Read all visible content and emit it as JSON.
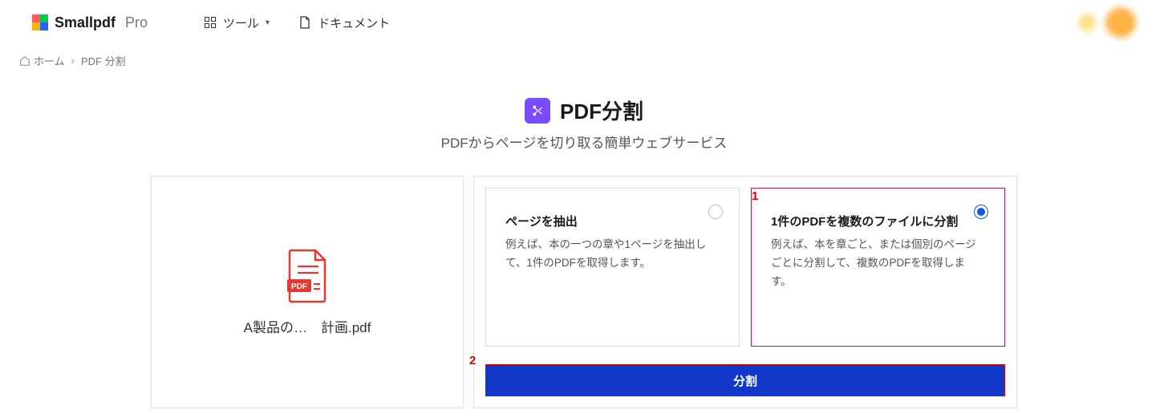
{
  "header": {
    "brand_main": "Smallpdf",
    "brand_suffix": "Pro",
    "nav": {
      "tools": "ツール",
      "documents": "ドキュメント"
    }
  },
  "breadcrumb": {
    "home": "ホーム",
    "separator": "›",
    "current": "PDF 分割"
  },
  "hero": {
    "title": "PDF分割",
    "subtitle": "PDFからページを切り取る簡単ウェブサービス"
  },
  "file": {
    "name": "A製品の…　計画.pdf"
  },
  "options": {
    "extract": {
      "title": "ページを抽出",
      "desc": "例えば、本の一つの章や1ページを抽出して、1件のPDFを取得します。",
      "selected": false
    },
    "split": {
      "title": "1件のPDFを複数のファイルに分割",
      "desc": "例えば、本を章ごと、または個別のページごとに分割して、複数のPDFを取得します。",
      "selected": true
    }
  },
  "actions": {
    "split_button": "分割"
  },
  "annotations": {
    "a1": "1",
    "a2": "2"
  },
  "colors": {
    "accent": "#7b4cff",
    "primary_button": "#1138c9",
    "selected_border": "#c2185b",
    "annotation": "#e20000"
  }
}
